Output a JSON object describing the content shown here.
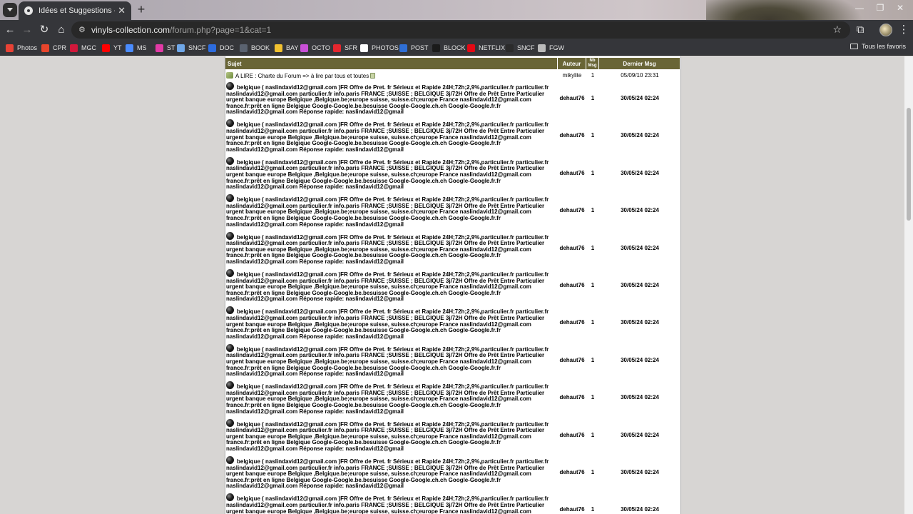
{
  "browser": {
    "tab_title": "Idées et Suggestions - Le Forum",
    "url_host": "vinyls-collection.com",
    "url_path": "/forum.php?page=1&cat=1",
    "bookmarks": [
      {
        "label": "Photos",
        "color": "#e94235"
      },
      {
        "label": "CPR",
        "color": "#e8452c"
      },
      {
        "label": "MGC",
        "color": "#d2183b"
      },
      {
        "label": "YT",
        "color": "#ff0000"
      },
      {
        "label": "MS",
        "color": "#4a8cff"
      },
      {
        "label": "ST",
        "color": "#e23aa6"
      },
      {
        "label": "SNCF",
        "color": "#6fa7e8"
      },
      {
        "label": "DOC",
        "color": "#2d6cdf"
      },
      {
        "label": "BOOK",
        "color": "#5a6270"
      },
      {
        "label": "BAY",
        "color": "#f2c230"
      },
      {
        "label": "OCTO",
        "color": "#c84fd6"
      },
      {
        "label": "SFR",
        "color": "#e4262e"
      },
      {
        "label": "PHOTOS",
        "color": "#ffffff"
      },
      {
        "label": "POST",
        "color": "#2f6fd6"
      },
      {
        "label": "BLOCK",
        "color": "#1b1b1b"
      },
      {
        "label": "NETFLIX",
        "color": "#e50914"
      },
      {
        "label": "SNCF",
        "color": "#2b2b2b"
      },
      {
        "label": "FGW",
        "color": "#bbbbbb"
      }
    ],
    "all_bookmarks": "Tous les favoris"
  },
  "forum": {
    "headers": {
      "sujet": "Sujet",
      "auteur": "Auteur",
      "nb_msg": "Nb Msg",
      "dernier_msg": "Dernier Msg"
    },
    "pinned": {
      "subject": "A LIRE : Charte du Forum => à lire par tous et toutes",
      "author": "mikylite",
      "count": "1",
      "date": "05/09/10 23:31"
    },
    "spam_subject": "belgique ( naslindavid12@gmail.com )FR Offre de Pret. fr Sérieux et Rapide 24H;72h;2,9%,particulier.fr particulier.fr naslindavid12@gmail.com particulier.fr info.paris FRANCE ;SUISSE ; BELGIQUE 3j/72H Offre de Prêt Entre Particulier urgent banque europe Belgique ,Belgique.be;europe suisse, suisse.ch;europe France naslindavid12@gmail.com france.fr:prêt en ligne Belgique Google-Google.be.besuisse Google-Google.ch.ch Google-Google.fr.fr naslindavid12@gmail.com Réponse rapide: naslindavid12@gmail",
    "rows": [
      {
        "author": "dehaut76",
        "count": "1",
        "date": "30/05/24 02:24"
      },
      {
        "author": "dehaut76",
        "count": "1",
        "date": "30/05/24 02:24"
      },
      {
        "author": "dehaut76",
        "count": "1",
        "date": "30/05/24 02:24"
      },
      {
        "author": "dehaut76",
        "count": "1",
        "date": "30/05/24 02:24"
      },
      {
        "author": "dehaut76",
        "count": "1",
        "date": "30/05/24 02:24"
      },
      {
        "author": "dehaut76",
        "count": "1",
        "date": "30/05/24 02:24"
      },
      {
        "author": "dehaut76",
        "count": "1",
        "date": "30/05/24 02:24"
      },
      {
        "author": "dehaut76",
        "count": "1",
        "date": "30/05/24 02:24"
      },
      {
        "author": "dehaut76",
        "count": "1",
        "date": "30/05/24 02:24"
      },
      {
        "author": "dehaut76",
        "count": "1",
        "date": "30/05/24 02:24"
      },
      {
        "author": "dehaut76",
        "count": "1",
        "date": "30/05/24 02:24"
      },
      {
        "author": "dehaut76",
        "count": "1",
        "date": "30/05/24 02:24"
      }
    ]
  }
}
